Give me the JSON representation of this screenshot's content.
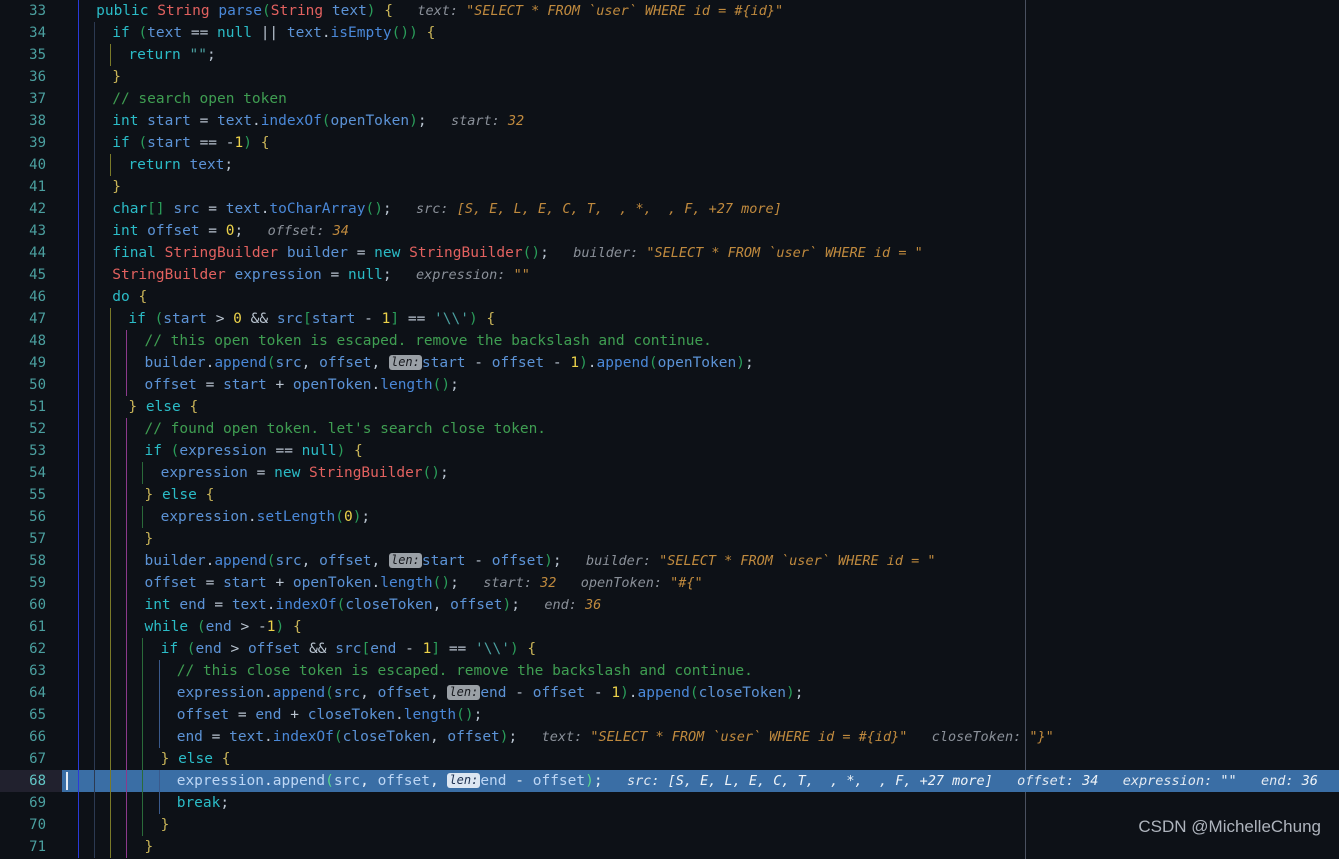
{
  "editor": {
    "theme": "dark-navy",
    "background_color": "#0d1117",
    "current_line_highlight_color": "#3a6ea5",
    "gutter_color": "#4ba0a0",
    "first_line_number": 33,
    "last_line_number": 71,
    "current_line_number": 68,
    "language": "Java",
    "right_margin_column_guide": true
  },
  "watermark": {
    "text": "CSDN @MichelleChung"
  },
  "lines": [
    {
      "number": "33",
      "indent": 2,
      "code": "public String parse(String text) {",
      "debug": [
        {
          "name": "text:",
          "value": "\"SELECT * FROM `user` WHERE id = #{id}\""
        }
      ]
    },
    {
      "number": "34",
      "indent": 4,
      "code": "if (text == null || text.isEmpty()) {",
      "debug": []
    },
    {
      "number": "35",
      "indent": 6,
      "code": "return \"\";",
      "debug": []
    },
    {
      "number": "36",
      "indent": 4,
      "code": "}",
      "debug": []
    },
    {
      "number": "37",
      "indent": 4,
      "code": "// search open token",
      "debug": []
    },
    {
      "number": "38",
      "indent": 4,
      "code": "int start = text.indexOf(openToken);",
      "debug": [
        {
          "name": "start:",
          "value": "32"
        }
      ]
    },
    {
      "number": "39",
      "indent": 4,
      "code": "if (start == -1) {",
      "debug": []
    },
    {
      "number": "40",
      "indent": 6,
      "code": "return text;",
      "debug": []
    },
    {
      "number": "41",
      "indent": 4,
      "code": "}",
      "debug": []
    },
    {
      "number": "42",
      "indent": 4,
      "code": "char[] src = text.toCharArray();",
      "debug": [
        {
          "name": "src:",
          "value": "[S, E, L, E, C, T,  , *,  , F, +27 more]"
        }
      ]
    },
    {
      "number": "43",
      "indent": 4,
      "code": "int offset = 0;",
      "debug": [
        {
          "name": "offset:",
          "value": "34"
        }
      ]
    },
    {
      "number": "44",
      "indent": 4,
      "code": "final StringBuilder builder = new StringBuilder();",
      "debug": [
        {
          "name": "builder:",
          "value": "\"SELECT * FROM `user` WHERE id = \""
        }
      ]
    },
    {
      "number": "45",
      "indent": 4,
      "code": "StringBuilder expression = null;",
      "debug": [
        {
          "name": "expression:",
          "value": "\"\""
        }
      ]
    },
    {
      "number": "46",
      "indent": 4,
      "code": "do {",
      "debug": []
    },
    {
      "number": "47",
      "indent": 6,
      "code": "if (start > 0 && src[start - 1] == '\\\\') {",
      "debug": []
    },
    {
      "number": "48",
      "indent": 8,
      "code": "// this open token is escaped. remove the backslash and continue.",
      "debug": []
    },
    {
      "number": "49",
      "indent": 8,
      "code": "builder.append(src, offset, len: start - offset - 1).append(openToken);",
      "debug": []
    },
    {
      "number": "50",
      "indent": 8,
      "code": "offset = start + openToken.length();",
      "debug": []
    },
    {
      "number": "51",
      "indent": 6,
      "code": "} else {",
      "debug": []
    },
    {
      "number": "52",
      "indent": 8,
      "code": "// found open token. let's search close token.",
      "debug": []
    },
    {
      "number": "53",
      "indent": 8,
      "code": "if (expression == null) {",
      "debug": []
    },
    {
      "number": "54",
      "indent": 10,
      "code": "expression = new StringBuilder();",
      "debug": []
    },
    {
      "number": "55",
      "indent": 8,
      "code": "} else {",
      "debug": []
    },
    {
      "number": "56",
      "indent": 10,
      "code": "expression.setLength(0);",
      "debug": []
    },
    {
      "number": "57",
      "indent": 8,
      "code": "}",
      "debug": []
    },
    {
      "number": "58",
      "indent": 8,
      "code": "builder.append(src, offset, len: start - offset);",
      "debug": [
        {
          "name": "builder:",
          "value": "\"SELECT * FROM `user` WHERE id = \""
        }
      ]
    },
    {
      "number": "59",
      "indent": 8,
      "code": "offset = start + openToken.length();",
      "debug": [
        {
          "name": "start:",
          "value": "32"
        },
        {
          "name": "openToken:",
          "value": "\"#{\""
        }
      ]
    },
    {
      "number": "60",
      "indent": 8,
      "code": "int end = text.indexOf(closeToken, offset);",
      "debug": [
        {
          "name": "end:",
          "value": "36"
        }
      ]
    },
    {
      "number": "61",
      "indent": 8,
      "code": "while (end > -1) {",
      "debug": []
    },
    {
      "number": "62",
      "indent": 10,
      "code": "if (end > offset && src[end - 1] == '\\\\') {",
      "debug": []
    },
    {
      "number": "63",
      "indent": 12,
      "code": "// this close token is escaped. remove the backslash and continue.",
      "debug": []
    },
    {
      "number": "64",
      "indent": 12,
      "code": "expression.append(src, offset, len: end - offset - 1).append(closeToken);",
      "debug": []
    },
    {
      "number": "65",
      "indent": 12,
      "code": "offset = end + closeToken.length();",
      "debug": []
    },
    {
      "number": "66",
      "indent": 12,
      "code": "end = text.indexOf(closeToken, offset);",
      "debug": [
        {
          "name": "text:",
          "value": "\"SELECT * FROM `user` WHERE id = #{id}\""
        },
        {
          "name": "closeToken:",
          "value": "\"}\""
        }
      ]
    },
    {
      "number": "67",
      "indent": 10,
      "code": "} else {",
      "debug": []
    },
    {
      "number": "68",
      "indent": 12,
      "code": "expression.append(src, offset, len: end - offset);",
      "current": true,
      "debug": [
        {
          "name": "src:",
          "value": "[S, E, L, E, C, T,  , *,  , F, +27 more]"
        },
        {
          "name": "offset:",
          "value": "34"
        },
        {
          "name": "expression:",
          "value": "\"\""
        },
        {
          "name": "end:",
          "value": "36"
        }
      ]
    },
    {
      "number": "69",
      "indent": 12,
      "code": "break;",
      "debug": []
    },
    {
      "number": "70",
      "indent": 10,
      "code": "}",
      "debug": []
    },
    {
      "number": "71",
      "indent": 8,
      "code": "}",
      "debug": []
    }
  ]
}
